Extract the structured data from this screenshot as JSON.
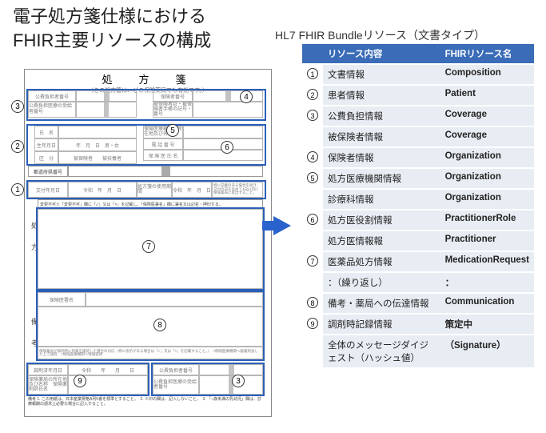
{
  "title_line1": "電子処方箋仕様における",
  "title_line2": "FHIR主要リソースの構成",
  "bundle_title": "HL7 FHIR Bundleリソース（文書タイプ）",
  "doc": {
    "title": "処　方　箋",
    "note": "（この処方箋は、どの保険薬局でも有効です。）",
    "f_payer_no": "公費負担者番号",
    "f_insurer_no": "保険者番号",
    "f_recipient_no": "公費負担医療の受給者番号",
    "f_insured_card": "被保険者証・被保険者手帳の記号・番号",
    "f_name": "氏　名",
    "f_birth": "生年月日",
    "f_birth_val": "年　月　日　男・女",
    "f_category": "区　分",
    "f_category_val": "被保険者　　被扶養者",
    "f_inst_name": "保険医療機関の所在地及び名称",
    "f_phone": "電 話 番 号",
    "f_doctor": "保 険 医 氏 名",
    "f_dept_code": "都道府県番号",
    "f_issue_date": "交付年月日",
    "f_issue_val": "令和　年　月　日",
    "f_valid": "処方箋の使用期間",
    "f_valid_val": "令和　年　月　日",
    "f_valid_note": "特に記載のある場合を除き、交付の日を含めて4日以内に保険薬局に提出すること。",
    "f_change_note": "変更不可※「変更不可」欄に「✓」又は「×」を記載し、「保険医署名」欄に署名又は記名・押印する。",
    "f_sig": "保険医署名",
    "f_remark_note": "保険薬局が調剤時に残薬を確認した場合の対応（特に指示がある場合は「✓」又は「×」を記載すること。）　□保険医療機関へ疑義照会した上で調剤　□保険医療機関へ情報提供",
    "f_disp_date": "調剤済年月日",
    "f_disp_date_val": "令和　　年　　月　　日",
    "f_pharmacy": "保険薬局の所在地及び名称　保険薬剤師氏名",
    "f_payer_no2": "公費負担者番号",
    "f_recipient_no2": "公費負担医療の受給者番号",
    "f_footer": "備考 1. この用紙は、日本産業規格A列5番を標準とすること。　2. ※印の欄は、記入しないこと。　3. 「○歳未満の乳幼児」欄は、診療報酬の請求上必要な場合に記入すること。",
    "v_prescription": "処　　方",
    "v_remarks": "備　　考"
  },
  "table": {
    "h1": "リソース内容",
    "h2": "FHIRリソース名",
    "rows": [
      {
        "n": "1",
        "label": "文書情報",
        "res": "Composition"
      },
      {
        "n": "2",
        "label": "患者情報",
        "res": "Patient"
      },
      {
        "n": "3",
        "label": "公費負担情報",
        "res": "Coverage"
      },
      {
        "n": "",
        "label": "被保険者情報",
        "res": "Coverage"
      },
      {
        "n": "4",
        "label": "保険者情報",
        "res": "Organization"
      },
      {
        "n": "5",
        "label": "処方医療機関情報",
        "res": "Organization"
      },
      {
        "n": "",
        "label": "診療科情報",
        "res": "Organization"
      },
      {
        "n": "6",
        "label": "処方医役割情報",
        "res": "PractitionerRole"
      },
      {
        "n": "",
        "label": "処方医情報報",
        "res": "Practitioner"
      },
      {
        "n": "7",
        "label": "医薬品処方情報",
        "res": "MedicationRequest"
      },
      {
        "n": "",
        "label": "：（繰り返し）",
        "res": "："
      },
      {
        "n": "8",
        "label": "備考・薬局への伝達情報",
        "res": "Communication"
      },
      {
        "n": "9",
        "label": "調剤時記録情報",
        "res": "策定中"
      },
      {
        "n": "",
        "label": "全体のメッセージダイジェスト（ハッシュ値）",
        "res": "（Signature）"
      }
    ]
  }
}
